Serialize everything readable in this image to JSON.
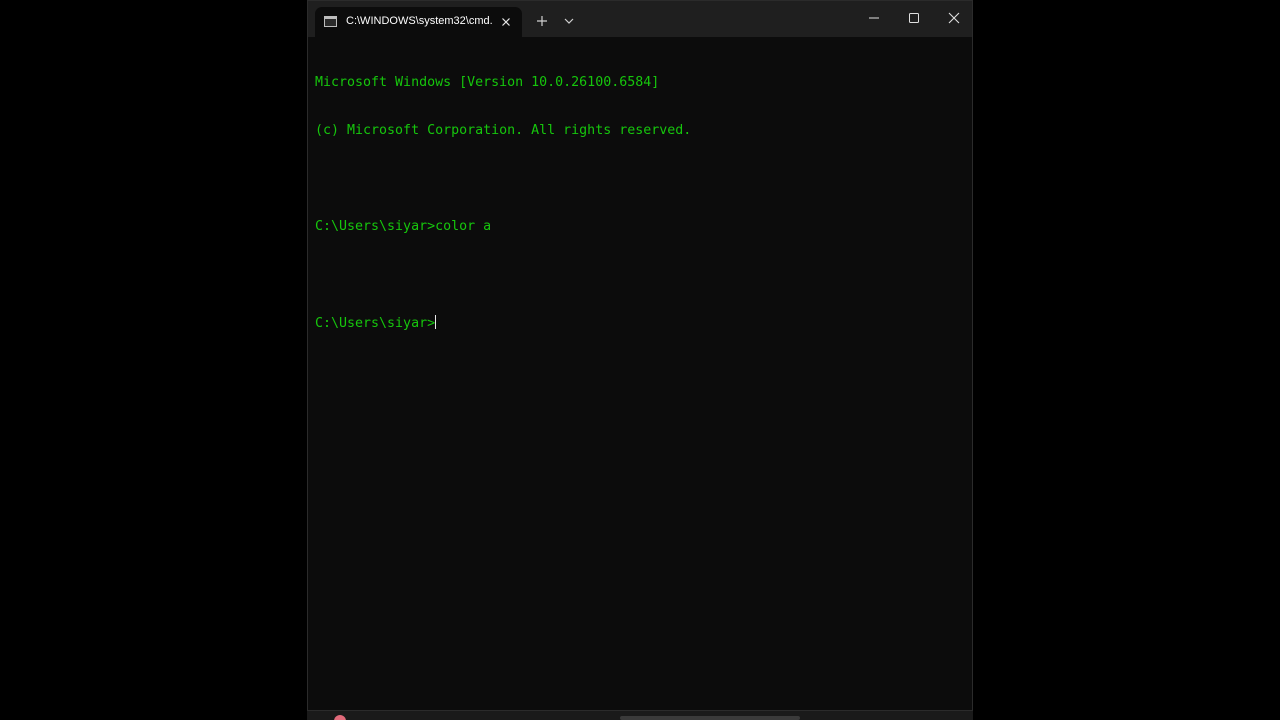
{
  "window": {
    "tab_title": "C:\\WINDOWS\\system32\\cmd.",
    "tab_icon": "terminal-icon",
    "new_tab_icon": "plus-icon",
    "dropdown_icon": "chevron-down-icon",
    "minimize_icon": "minimize-icon",
    "maximize_icon": "maximize-icon",
    "close_icon": "close-icon"
  },
  "console": {
    "lines": [
      "Microsoft Windows [Version 10.0.26100.6584]",
      "(c) Microsoft Corporation. All rights reserved.",
      "",
      "C:\\Users\\siyar>color a",
      "",
      "C:\\Users\\siyar>"
    ],
    "text_color": "#16c60c",
    "background_color": "#0c0c0c"
  }
}
